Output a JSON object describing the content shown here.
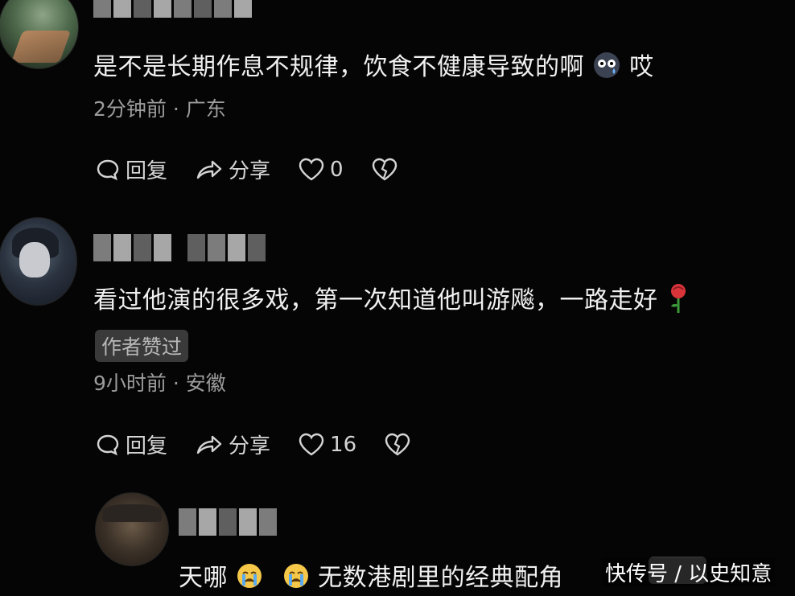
{
  "comments": [
    {
      "text": "是不是长期作息不规律，饮食不健康导致的啊",
      "text_tail": "哎",
      "emoji": "sweat-emoji",
      "time_location": "2分钟前 · 广东",
      "reply_label": "回复",
      "share_label": "分享",
      "like_count": "0"
    },
    {
      "text": "看过他演的很多戏，第一次知道他叫游飚，一路走好",
      "emoji": "rose-emoji",
      "badge": "作者赞过",
      "time_location": "9小时前 · 安徽",
      "reply_label": "回复",
      "share_label": "分享",
      "like_count": "16"
    },
    {
      "text_prefix": "天哪",
      "text": "无数港剧里的经典配角",
      "emoji": "crying-emoji"
    }
  ],
  "watermark": "快传号 / 以史知意",
  "colors": {
    "background": "#050505",
    "text": "#f0f0f0",
    "meta": "#9c9c9c",
    "badge_bg": "#3a3a3a"
  }
}
